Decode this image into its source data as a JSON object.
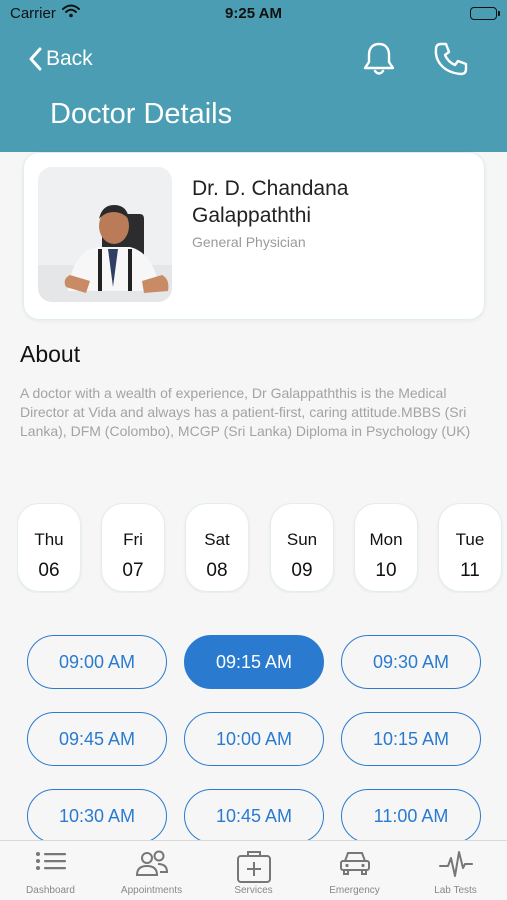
{
  "status_bar": {
    "carrier": "Carrier",
    "time": "9:25 AM"
  },
  "nav": {
    "back_label": "Back",
    "title": "Doctor Details",
    "color": "#4a9db3"
  },
  "doctor": {
    "name": "Dr. D. Chandana Galappaththi",
    "specialty": "General Physician"
  },
  "about": {
    "heading": "About",
    "text": "A doctor with a wealth of experience, Dr Galappaththis is the Medical Director at Vida and always has a patient-first, caring attitude.MBBS (Sri Lanka), DFM (Colombo), MCGP (Sri Lanka) Diploma in Psychology (UK)"
  },
  "days": [
    {
      "day": "Thu",
      "date": "06"
    },
    {
      "day": "Fri",
      "date": "07"
    },
    {
      "day": "Sat",
      "date": "08"
    },
    {
      "day": "Sun",
      "date": "09"
    },
    {
      "day": "Mon",
      "date": "10"
    },
    {
      "day": "Tue",
      "date": "11"
    }
  ],
  "slots": [
    {
      "time": "09:00 AM",
      "selected": false
    },
    {
      "time": "09:15 AM",
      "selected": true
    },
    {
      "time": "09:30 AM",
      "selected": false
    },
    {
      "time": "09:45 AM",
      "selected": false
    },
    {
      "time": "10:00 AM",
      "selected": false
    },
    {
      "time": "10:15 AM",
      "selected": false
    },
    {
      "time": "10:30 AM",
      "selected": false
    },
    {
      "time": "10:45 AM",
      "selected": false
    },
    {
      "time": "11:00 AM",
      "selected": false
    }
  ],
  "accent_color": "#2a7bd0",
  "tabs": [
    {
      "label": "Dashboard",
      "icon": "list-icon"
    },
    {
      "label": "Appointments",
      "icon": "people-icon"
    },
    {
      "label": "Services",
      "icon": "medical-kit-icon"
    },
    {
      "label": "Emergency",
      "icon": "car-icon"
    },
    {
      "label": "Lab Tests",
      "icon": "heartbeat-icon"
    }
  ]
}
